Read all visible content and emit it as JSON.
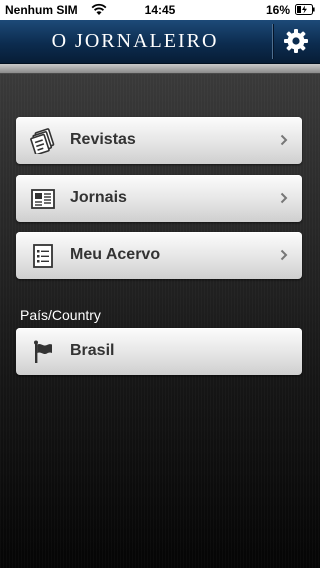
{
  "status_bar": {
    "carrier": "Nenhum SIM",
    "time": "14:45",
    "battery": "16%"
  },
  "nav": {
    "title": "O JORNALEIRO",
    "settings_icon": "gear-icon"
  },
  "menu": [
    {
      "label": "Revistas",
      "icon": "magazines-icon"
    },
    {
      "label": "Jornais",
      "icon": "newspaper-icon"
    },
    {
      "label": "Meu Acervo",
      "icon": "list-icon"
    }
  ],
  "country_section": {
    "label": "País/Country",
    "selected": "Brasil",
    "icon": "flag-icon"
  },
  "colors": {
    "nav_background": "#0c2c4f",
    "button_background": "#e7e7e7",
    "button_text": "#333333"
  }
}
